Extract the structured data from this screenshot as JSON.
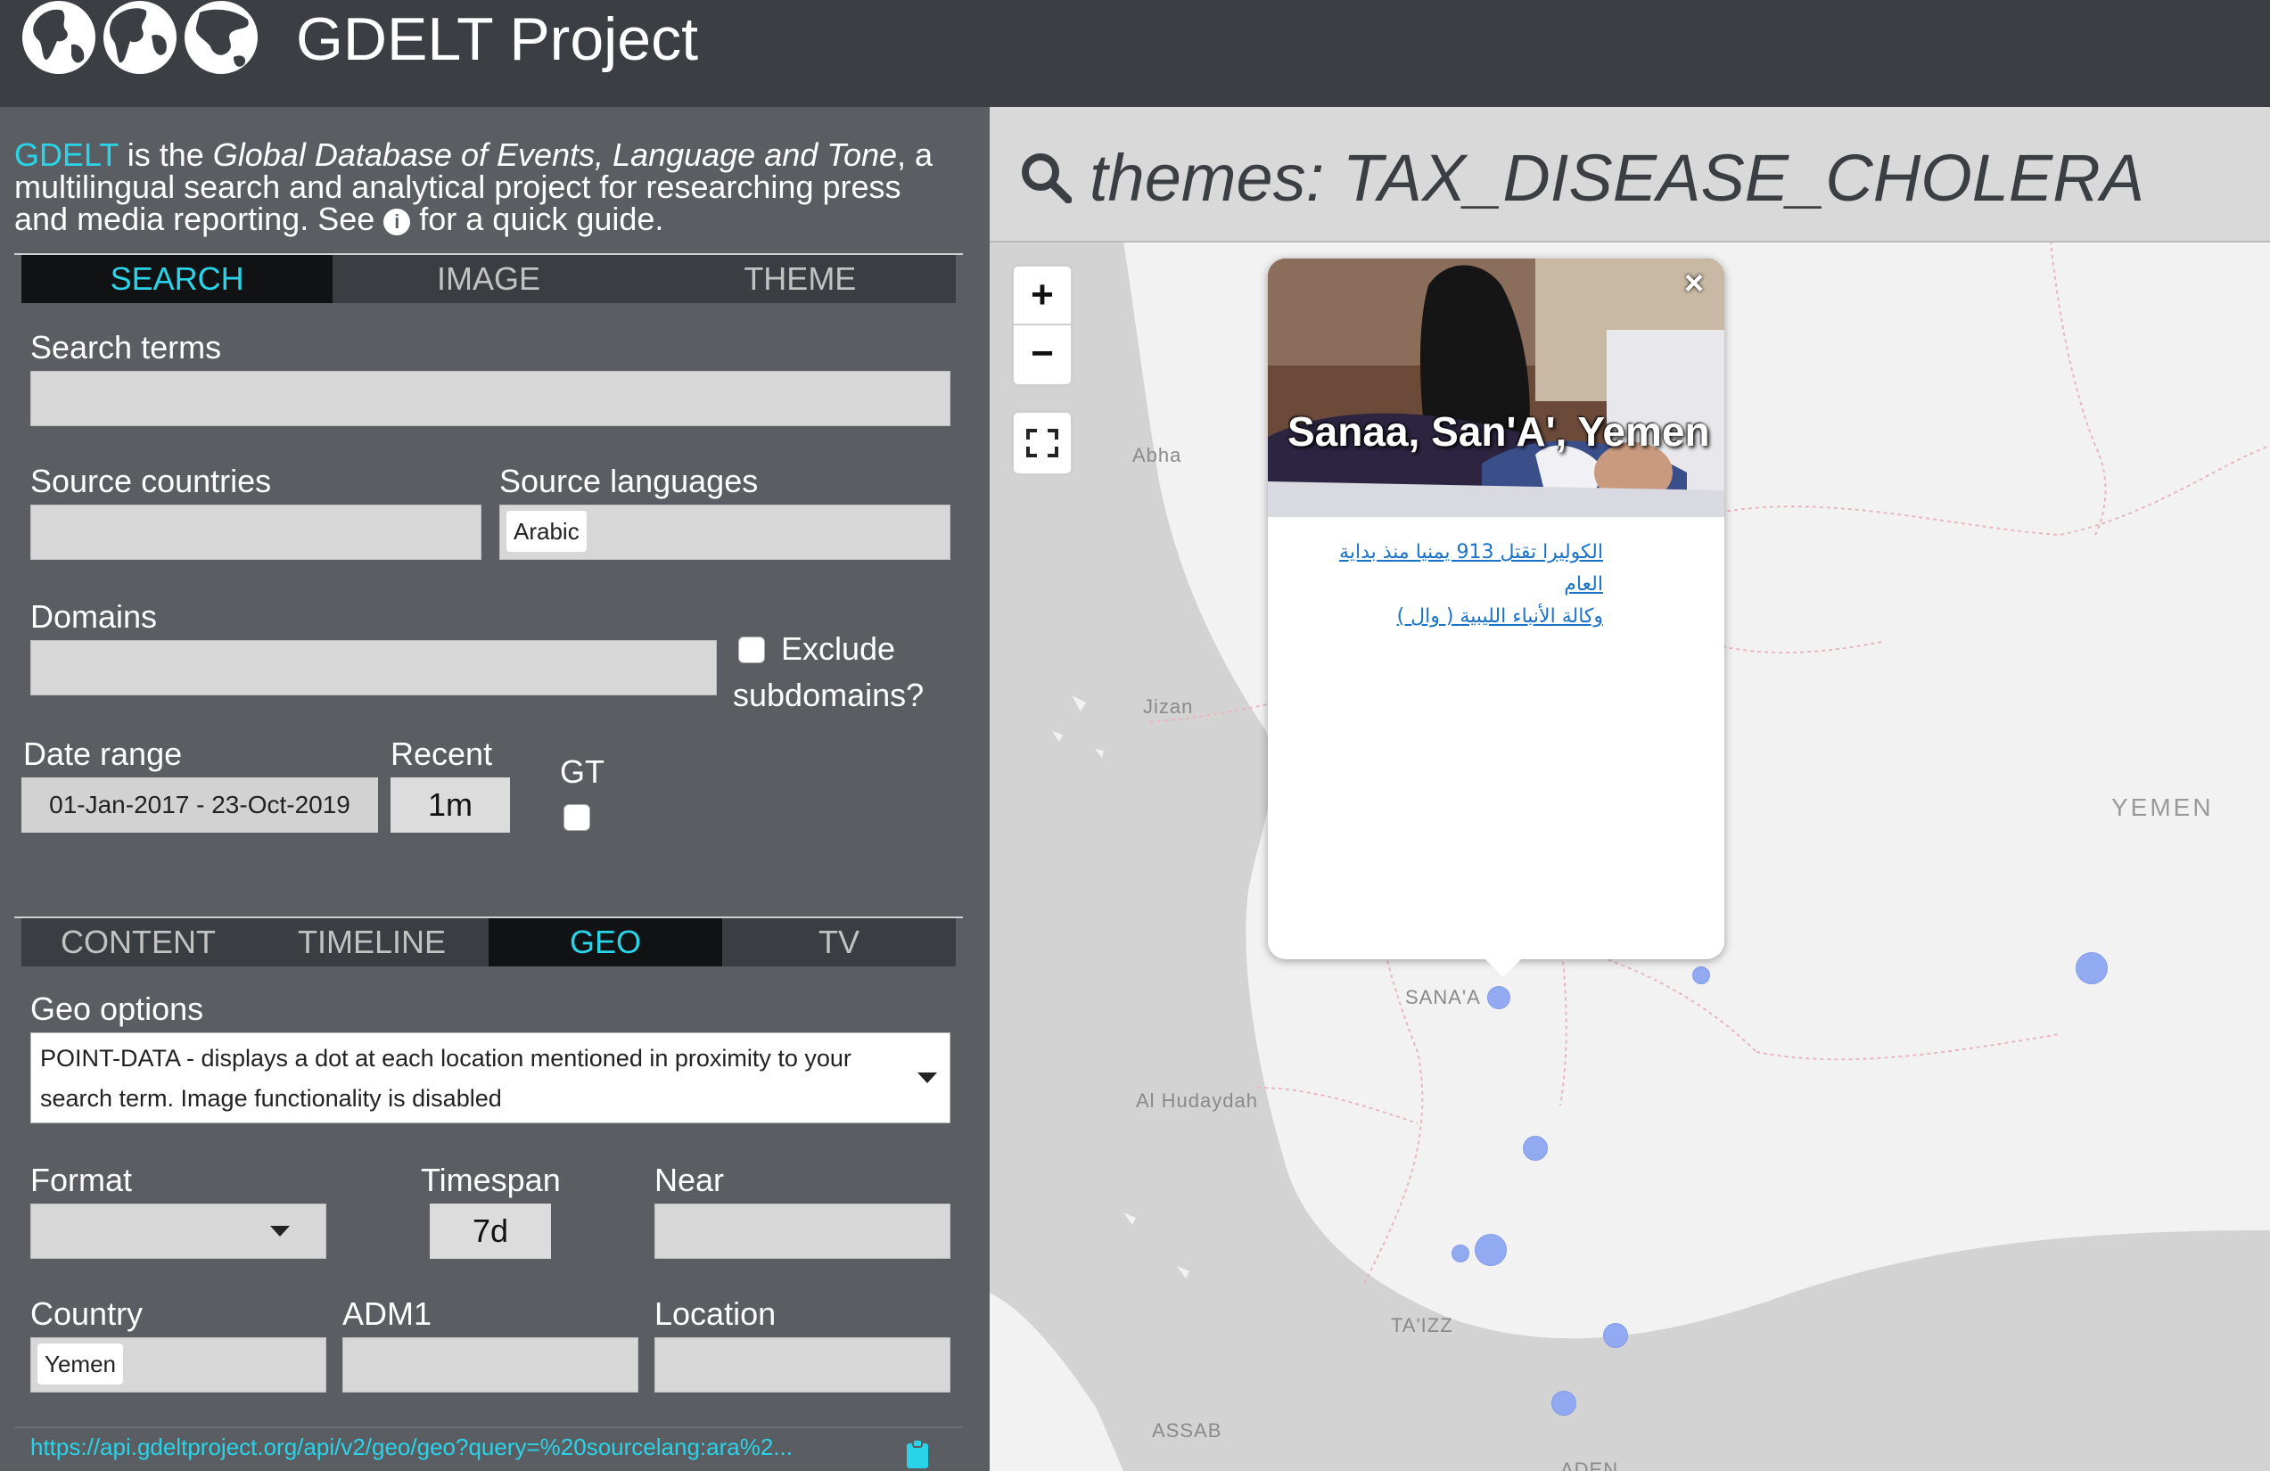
{
  "header": {
    "title": "GDELT Project",
    "logo_icon": "three-globes-logo-icon"
  },
  "intro": {
    "brand": "GDELT",
    "text_1": " is the ",
    "italic": "Global Database of Events, Language and Tone",
    "text_2": ", a multilingual search and analytical project for researching press and media reporting. See ",
    "text_3": " for a quick guide.",
    "info_icon": "i"
  },
  "top_tabs": [
    "SEARCH",
    "IMAGE",
    "THEME"
  ],
  "top_tabs_active": "SEARCH",
  "form": {
    "search_terms_label": "Search terms",
    "search_terms_value": "",
    "source_countries_label": "Source countries",
    "source_languages_label": "Source languages",
    "source_languages_chip": "Arabic",
    "domains_label": "Domains",
    "exclude_subdomains_line1": "Exclude",
    "exclude_subdomains_line2": "subdomains?",
    "date_range_label": "Date range",
    "date_range_value": "01-Jan-2017 - 23-Oct-2019",
    "recent_label": "Recent",
    "recent_value": "1m",
    "gt_label": "GT"
  },
  "bottom_tabs": [
    "CONTENT",
    "TIMELINE",
    "GEO",
    "TV"
  ],
  "bottom_tabs_active": "GEO",
  "geo": {
    "options_label": "Geo options",
    "options_value": "POINT-DATA - displays a dot at each location mentioned in proximity to your search term. Image functionality is disabled",
    "format_label": "Format",
    "format_value": "",
    "timespan_label": "Timespan",
    "timespan_value": "7d",
    "near_label": "Near",
    "country_label": "Country",
    "country_chip": "Yemen",
    "adm1_label": "ADM1",
    "location_label": "Location"
  },
  "api_url": "https://api.gdeltproject.org/api/v2/geo/geo?query=%20sourcelang:ara%2...",
  "search": {
    "query": "themes: TAX_DISEASE_CHOLERA",
    "icon": "search-icon"
  },
  "map_controls": {
    "zoom_in": "+",
    "zoom_out": "−",
    "fullscreen_icon": "fullscreen-icon"
  },
  "map_labels": {
    "abha": "Abha",
    "jizan": "Jizan",
    "yemen": "YEMEN",
    "sanaa": "SANA'A",
    "hudaydah": "Al Hudaydah",
    "taizz": "TA'IZZ",
    "assab": "ASSAB",
    "aden": "ADEN"
  },
  "popup": {
    "location": "Sanaa, San'A', Yemen",
    "close": "×",
    "article_title": "الكوليرا تقتل 913 يمنيا منذ بداية العام",
    "article_source": "وكالة الأنباء الليبية ( وال )"
  },
  "colors": {
    "accent": "#2ad4e8",
    "header_bg": "#3b3f44",
    "panel_bg": "#5a5e63",
    "dot": "#8da7f3"
  }
}
